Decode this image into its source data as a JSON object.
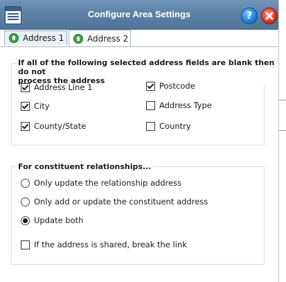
{
  "window": {
    "title": "Configure Area Settings"
  },
  "tabs": [
    {
      "label": "Address 1"
    },
    {
      "label": "Address 2"
    }
  ],
  "blank_fields_group": {
    "title_line1": "If all of the following selected address fields are blank then do not",
    "title_line2": "process the address",
    "fields": [
      {
        "label": "Address Line 1",
        "checked": true
      },
      {
        "label": "Postcode",
        "checked": true
      },
      {
        "label": "City",
        "checked": true
      },
      {
        "label": "Address Type",
        "checked": false
      },
      {
        "label": "County/State",
        "checked": true
      },
      {
        "label": "Country",
        "checked": false
      }
    ]
  },
  "relationships_group": {
    "title": "For constituent relationships...",
    "options": [
      {
        "label": "Only update the relationship address",
        "selected": false
      },
      {
        "label": "Only add or update the constituent address",
        "selected": false
      },
      {
        "label": "Update both",
        "selected": true
      }
    ],
    "break_link": {
      "label": "If the address is shared, break the link",
      "checked": false
    }
  }
}
